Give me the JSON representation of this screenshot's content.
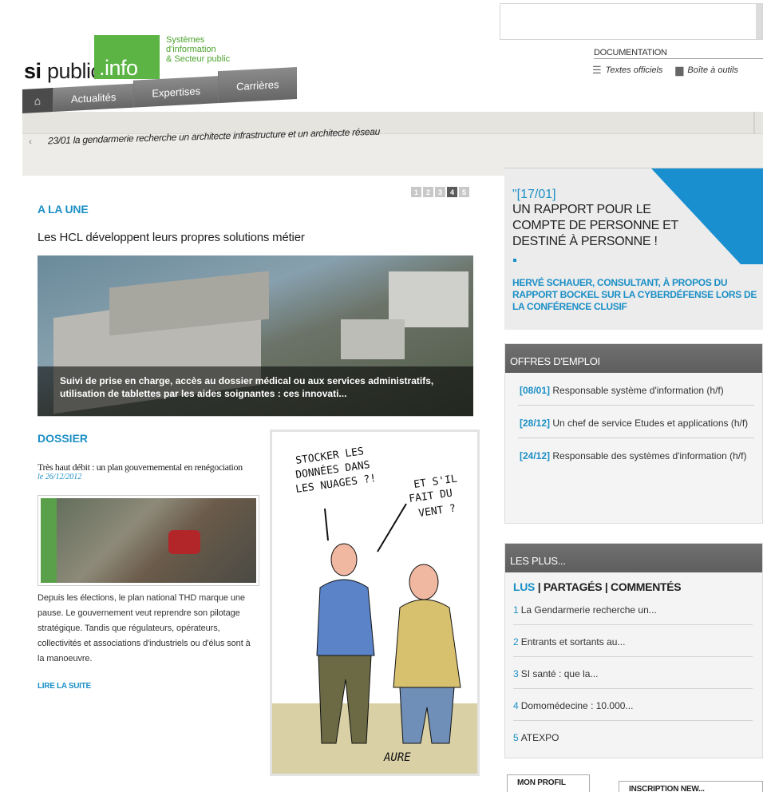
{
  "search": {
    "placeholder": ""
  },
  "logo": {
    "si": "si",
    "public": "public",
    "info": ".info",
    "tagline_1": "Systèmes",
    "tagline_2": "d'information",
    "tagline_3": "& Secteur public"
  },
  "header_links": {
    "documentation": "DOCUMENTATION",
    "textes_officiels": "Textes officiels",
    "boite_outils": "Boîte à outils"
  },
  "nav": {
    "home_icon": "home-icon",
    "items": [
      "Actualités",
      "Expertises",
      "Carrières"
    ]
  },
  "ticker": {
    "text": "23/01 la gendarmerie recherche un architecte infrastructure et un architecte réseau"
  },
  "a_la_une": {
    "section_title": "A LA UNE",
    "pager": [
      "1",
      "2",
      "3",
      "4",
      "5"
    ],
    "active_page": "4",
    "headline": "Les HCL développent leurs propres solutions métier",
    "caption": "Suivi de prise en charge, accès au dossier médical ou aux services administratifs, utilisation de tablettes par les aides soignantes : ces innovati..."
  },
  "dossier": {
    "section_title": "DOSSIER",
    "title": "Très haut débit : un plan gouvernemental en renégociation",
    "date": "le 26/12/2012",
    "text": "Depuis les élections, le plan national THD marque une pause. Le gouvernement veut reprendre son pilotage stratégique. Tandis que régulateurs, opérateurs, collectivités et associations d'industriels ou d'élus sont à la manoeuvre.",
    "read_more": "LIRE LA SUITE"
  },
  "cartoon": {
    "bubble_1": [
      "STOCKER LES",
      "DONNÉES DANS",
      "LES NUAGES ?!"
    ],
    "bubble_2": [
      "ET S'IL",
      "FAIT DU",
      "VENT ?"
    ],
    "signature": "AURE"
  },
  "quote": {
    "date": "\"[17/01]",
    "text": "UN RAPPORT POUR LE COMPTE DE PERSONNE ET DESTINÉ À PERSONNE !",
    "author": "HERVÉ SCHAUER, CONSULTANT, À PROPOS DU RAPPORT BOCKEL SUR LA CYBERDÉFENSE LORS DE LA CONFÉRENCE CLUSIF"
  },
  "offres": {
    "title": "OFFRES D'EMPLOI",
    "jobs": [
      {
        "date": "[08/01]",
        "label": "Responsable système d'information (h/f)"
      },
      {
        "date": "[28/12]",
        "label": "Un chef de service Etudes et applications (h/f)"
      },
      {
        "date": "[24/12]",
        "label": "Responsable des systèmes d'information (h/f)"
      }
    ]
  },
  "les_plus": {
    "title": "LES PLUS...",
    "tab_lus": "LUS",
    "tab_partages": "PARTAGÉS",
    "tab_commentes": "COMMENTÉS",
    "separator": "|",
    "items": [
      {
        "n": "1",
        "label": "La Gendarmerie recherche un..."
      },
      {
        "n": "2",
        "label": "Entrants et sortants au..."
      },
      {
        "n": "3",
        "label": "SI santé : que la..."
      },
      {
        "n": "4",
        "label": "Domomédecine : 10.000..."
      },
      {
        "n": "5",
        "label": "ATEXPO"
      }
    ]
  },
  "footer_tabs": {
    "profil": "MON PROFIL",
    "inscription": "INSCRIPTION NEW..."
  }
}
